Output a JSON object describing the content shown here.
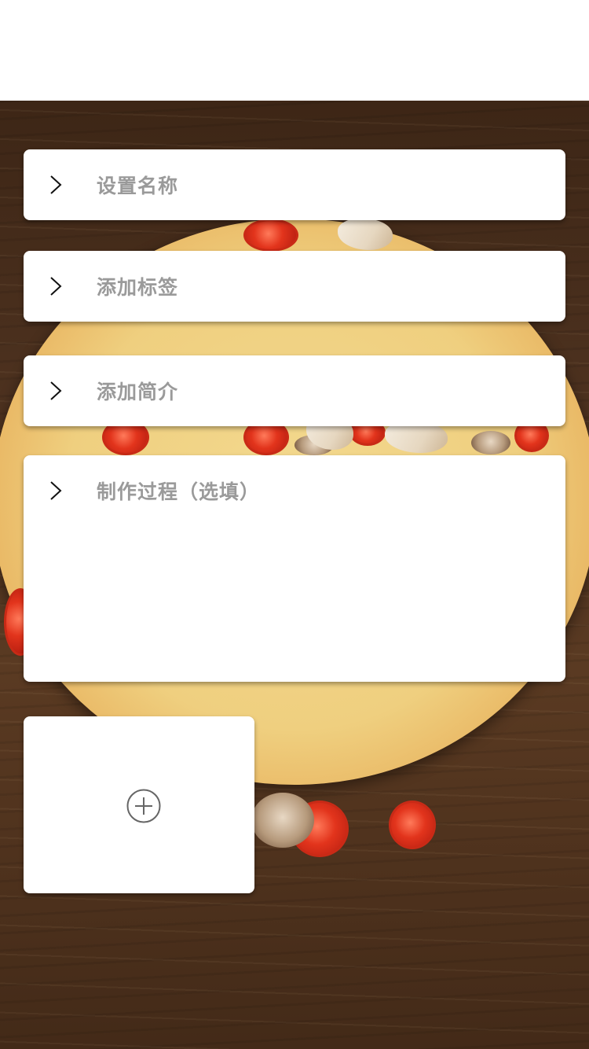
{
  "form": {
    "name_label": "设置名称",
    "tags_label": "添加标签",
    "intro_label": "添加简介",
    "process_label": "制作过程（选填）"
  },
  "icons": {
    "row_chevron": "chevron-right-icon",
    "upload": "plus-circle-icon"
  },
  "colors": {
    "label_text": "#9a9a9a",
    "card_bg": "#ffffff",
    "background_wood": "#4f3320"
  }
}
